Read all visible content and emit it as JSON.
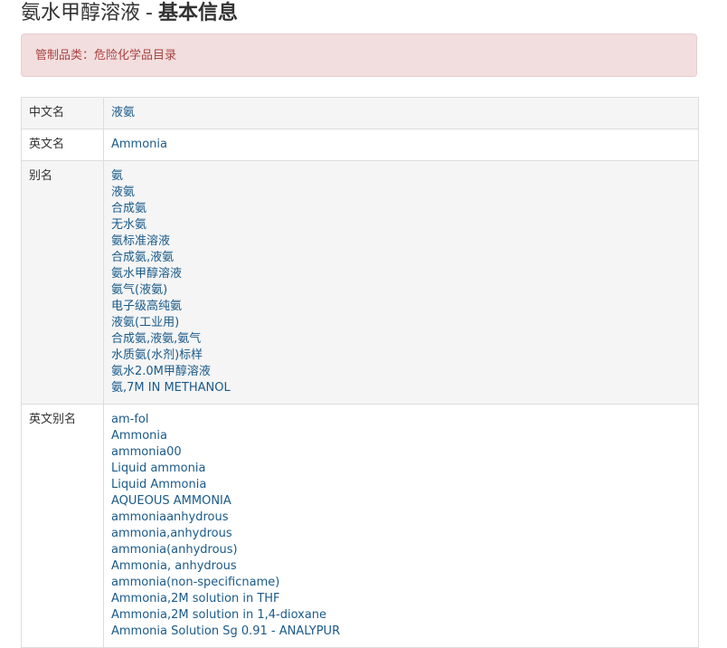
{
  "heading": {
    "title": "氨水甲醇溶液",
    "separator": "-",
    "subtitle": "基本信息"
  },
  "alert": {
    "text": "管制品类：危险化学品目录"
  },
  "rows": [
    {
      "label": "中文名",
      "values": [
        "液氨"
      ]
    },
    {
      "label": "英文名",
      "values": [
        "Ammonia"
      ]
    },
    {
      "label": "别名",
      "values": [
        "氨",
        "液氨",
        "合成氨",
        "无水氨",
        "氨标准溶液",
        "合成氨,液氨",
        "氨水甲醇溶液",
        "氨气(液氨)",
        "电子级高纯氨",
        "液氨(工业用)",
        "合成氨,液氨,氨气",
        "水质氨(水剂)标样",
        "氨水2.0M甲醇溶液",
        "氨,7M IN METHANOL"
      ]
    },
    {
      "label": "英文别名",
      "values": [
        "am-fol",
        "Ammonia",
        "ammonia00",
        "Liquid ammonia",
        "Liquid Ammonia",
        "AQUEOUS AMMONIA",
        "ammoniaanhydrous",
        "ammonia,anhydrous",
        "ammonia(anhydrous)",
        "Ammonia, anhydrous",
        "ammonia(non-specificname)",
        "Ammonia,2M solution in THF",
        "Ammonia,2M solution in 1,4-dioxane",
        "Ammonia Solution Sg 0.91 - ANALYPUR"
      ]
    }
  ],
  "colors": {
    "link": "#1a5a8a",
    "alert_bg": "#f2dede",
    "alert_text": "#a94442",
    "border": "#dddddd",
    "stripe": "#f5f5f5"
  }
}
